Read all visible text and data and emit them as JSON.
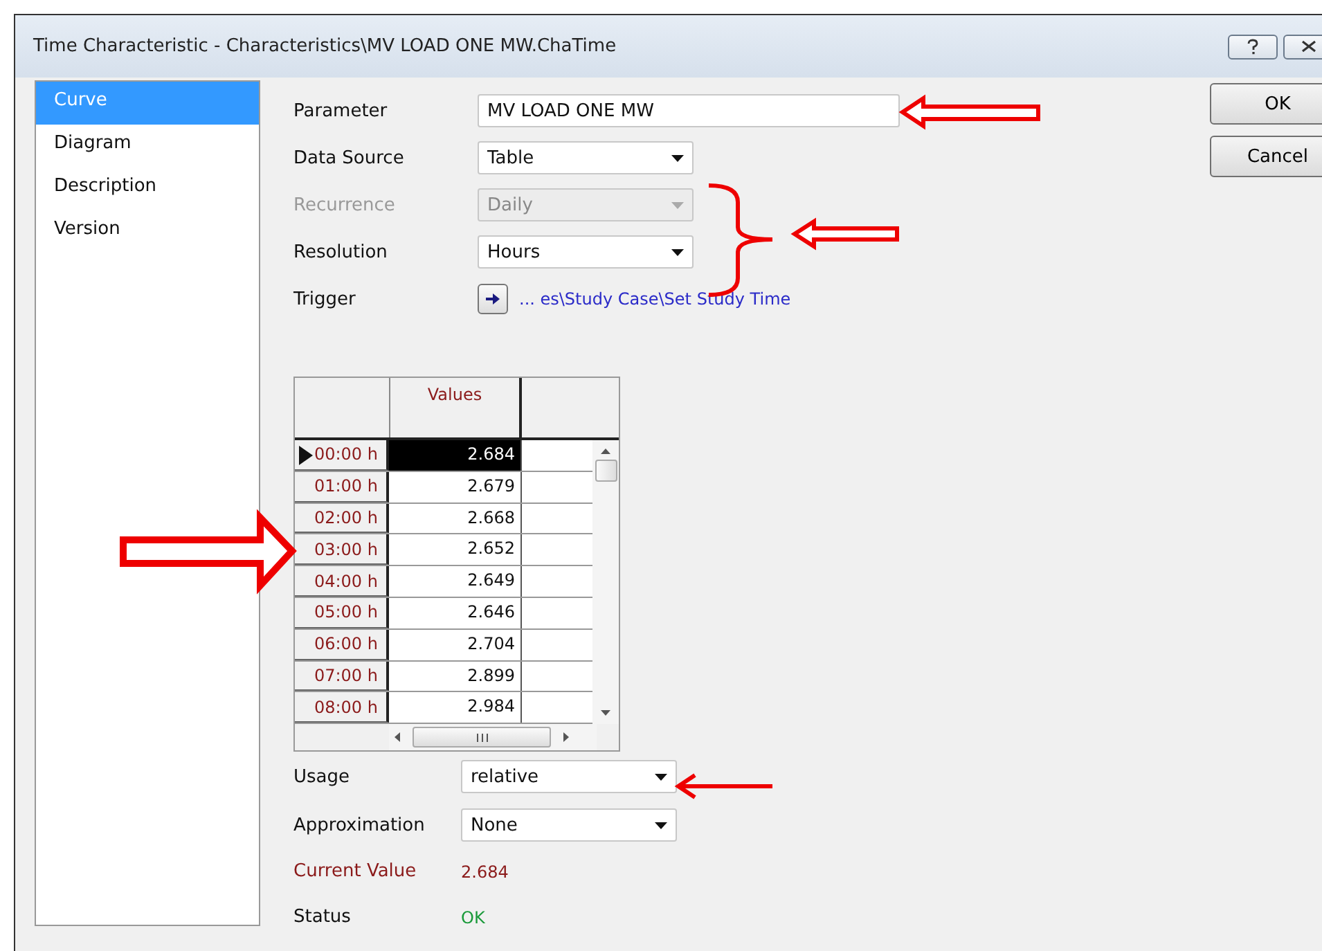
{
  "window": {
    "title": "Time Characteristic - Characteristics\\MV LOAD ONE MW.ChaTime"
  },
  "sidebar": {
    "items": [
      {
        "label": "Curve",
        "selected": true
      },
      {
        "label": "Diagram",
        "selected": false
      },
      {
        "label": "Description",
        "selected": false
      },
      {
        "label": "Version",
        "selected": false
      }
    ]
  },
  "fields": [
    {
      "kind": "text",
      "label": "Parameter",
      "value": "MV LOAD ONE MW",
      "disabled": false
    },
    {
      "kind": "dropdown",
      "label": "Data Source",
      "value": "Table",
      "disabled": false
    },
    {
      "kind": "dropdown",
      "label": "Recurrence",
      "value": "Daily",
      "disabled": true
    },
    {
      "kind": "dropdown",
      "label": "Resolution",
      "value": "Hours",
      "disabled": false
    },
    {
      "kind": "link",
      "label": "Trigger",
      "value": "... es\\Study Case\\Set Study Time",
      "disabled": false
    }
  ],
  "table": {
    "columns": [
      "Values"
    ],
    "rows": [
      {
        "time": "00:00 h",
        "value": "2.684",
        "selected": true
      },
      {
        "time": "01:00 h",
        "value": "2.679",
        "selected": false
      },
      {
        "time": "02:00 h",
        "value": "2.668",
        "selected": false
      },
      {
        "time": "03:00 h",
        "value": "2.652",
        "selected": false
      },
      {
        "time": "04:00 h",
        "value": "2.649",
        "selected": false
      },
      {
        "time": "05:00 h",
        "value": "2.646",
        "selected": false
      },
      {
        "time": "06:00 h",
        "value": "2.704",
        "selected": false
      },
      {
        "time": "07:00 h",
        "value": "2.899",
        "selected": false
      },
      {
        "time": "08:00 h",
        "value": "2.984",
        "selected": false
      }
    ]
  },
  "lower_fields": [
    {
      "label": "Usage",
      "value": "relative"
    },
    {
      "label": "Approximation",
      "value": "None"
    }
  ],
  "readouts": [
    {
      "kind": "computed",
      "label": "Current Value",
      "value": "2.684"
    },
    {
      "kind": "status",
      "label": "Status",
      "value": "OK"
    }
  ],
  "buttons": [
    "OK",
    "Cancel"
  ]
}
